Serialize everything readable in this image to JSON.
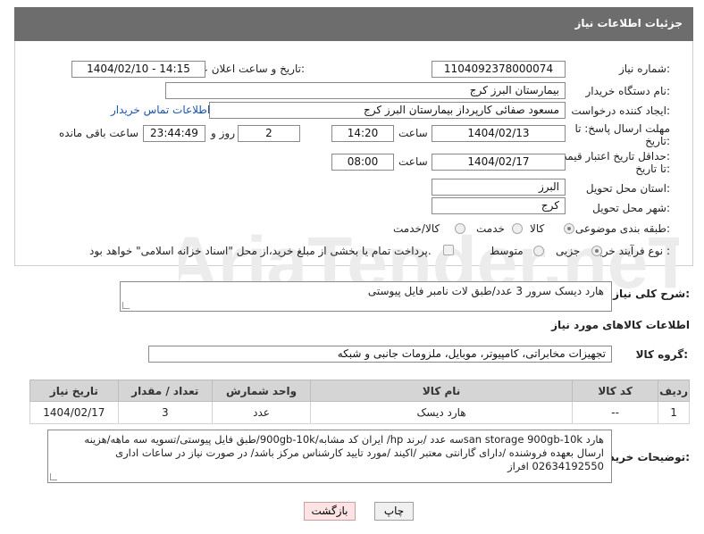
{
  "header": {
    "title": "جزئیات اطلاعات نیاز"
  },
  "fields": {
    "need_number": {
      "label": "شماره نیاز:",
      "value": "1104092378000074"
    },
    "announce": {
      "label": "تاریخ و ساعت اعلان عمومی:",
      "value": "1404/02/10 - 14:15"
    },
    "buyer_org": {
      "label": "نام دستگاه خریدار:",
      "value": "بیمارستان البرز کرج"
    },
    "requester": {
      "label": "ایجاد کننده درخواست:",
      "value": "مسعود صفائی کارپرداز بیمارستان البرز کرج",
      "contact_link": "اطلاعات تماس خریدار"
    },
    "deadline": {
      "label": "مهلت ارسال پاسخ: تا تاریخ:",
      "date": "1404/02/13",
      "time_label": "ساعت",
      "time": "14:20",
      "days": "2",
      "days_label": "روز و",
      "remaining": "23:44:49",
      "remaining_label": "ساعت باقی مانده"
    },
    "validity": {
      "label": "حداقل تاریخ اعتبار قیمت: تا تاریخ:",
      "date": "1404/02/17",
      "time_label": "ساعت",
      "time": "08:00"
    },
    "province": {
      "label": "استان محل تحویل:",
      "value": "البرز"
    },
    "city": {
      "label": "شهر محل تحویل:",
      "value": "کرج"
    },
    "category": {
      "label": "طبقه بندی موضوعی:",
      "options": [
        "کالا",
        "خدمت",
        "کالا/خدمت"
      ],
      "selected": "کالا"
    },
    "process": {
      "label": "نوع فرآیند خرید :",
      "options": [
        "جزیی",
        "متوسط"
      ],
      "selected": "جزیی",
      "payment_note": "پرداخت تمام یا بخشی از مبلغ خرید،از محل \"اسناد خزانه اسلامی\" خواهد بود."
    }
  },
  "summary": {
    "label": "شرح کلی نیاز:",
    "value": "هارد دیسک سرور 3 عدد/طبق لات نامبر فایل پیوستی"
  },
  "goods": {
    "title": "اطلاعات کالاهای مورد نیاز",
    "group_label": "گروه کالا:",
    "group_value": "تجهیزات مخابراتی، کامپیوتر، موبایل، ملزومات جانبی و شبکه",
    "columns": [
      "ردیف",
      "کد کالا",
      "نام کالا",
      "واحد شمارش",
      "تعداد / مقدار",
      "تاریخ نیاز"
    ],
    "rows": [
      {
        "index": "1",
        "code": "--",
        "name": "هارد دیسک",
        "unit": "عدد",
        "qty": "3",
        "date": "1404/02/17"
      }
    ]
  },
  "buyer_notes": {
    "label": "توضیحات خریدار:",
    "line1": "هارد san storage 900gb-10kسه عدد /برند hp/ ایران کد مشابه/900gb-10k/طبق فایل پیوستی/تسویه سه ماهه/هزینه",
    "line2": "ارسال بعهده فروشنده /دارای گارانتی معتبر /اکیند /مورد تایید کارشناس مرکز باشد/ در صورت نیاز در ساعات اداری",
    "line3": "02634192550 افراز"
  },
  "buttons": {
    "print": "چاپ",
    "back": "بازگشت"
  },
  "watermark": {
    "text": "AriaTender.neT"
  },
  "colors": {
    "header_bg": "#6d6d6d",
    "link": "#1a55b0",
    "back_button_bg": "#fde3e3",
    "watermark": "#e6e6e6"
  }
}
